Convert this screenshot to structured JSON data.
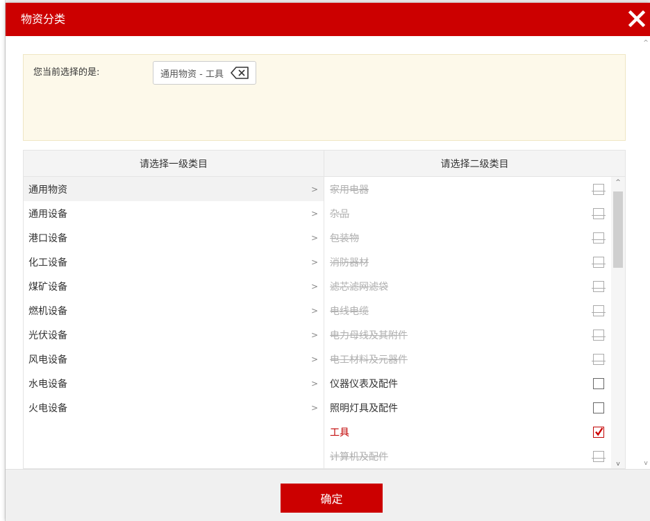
{
  "dialog": {
    "title": "物资分类",
    "close_icon": "close-icon"
  },
  "selection": {
    "label": "您当前选择的是:",
    "tag_text": "通用物资 - 工具",
    "tag_icon": "backspace-delete-icon"
  },
  "primary": {
    "header": "请选择一级类目",
    "chevron": ">",
    "items": [
      {
        "label": "通用物资",
        "active": true
      },
      {
        "label": "通用设备",
        "active": false
      },
      {
        "label": "港口设备",
        "active": false
      },
      {
        "label": "化工设备",
        "active": false
      },
      {
        "label": "煤矿设备",
        "active": false
      },
      {
        "label": "燃机设备",
        "active": false
      },
      {
        "label": "光伏设备",
        "active": false
      },
      {
        "label": "风电设备",
        "active": false
      },
      {
        "label": "水电设备",
        "active": false
      },
      {
        "label": "火电设备",
        "active": false
      }
    ]
  },
  "secondary": {
    "header": "请选择二级类目",
    "items": [
      {
        "label": "家用电器",
        "state": "disabled",
        "checked": false
      },
      {
        "label": "杂品",
        "state": "disabled",
        "checked": false
      },
      {
        "label": "包装物",
        "state": "disabled",
        "checked": false
      },
      {
        "label": "消防器材",
        "state": "disabled",
        "checked": false
      },
      {
        "label": "滤芯滤网滤袋",
        "state": "disabled",
        "checked": false
      },
      {
        "label": "电线电缆",
        "state": "disabled",
        "checked": false
      },
      {
        "label": "电力母线及其附件",
        "state": "disabled",
        "checked": false
      },
      {
        "label": "电工材料及元器件",
        "state": "disabled",
        "checked": false
      },
      {
        "label": "仪器仪表及配件",
        "state": "enabled",
        "checked": false
      },
      {
        "label": "照明灯具及配件",
        "state": "enabled",
        "checked": false
      },
      {
        "label": "工具",
        "state": "selected",
        "checked": true
      },
      {
        "label": "计算机及配件",
        "state": "disabled",
        "checked": false
      }
    ]
  },
  "footer": {
    "confirm_label": "确定"
  },
  "colors": {
    "brand": "#cc0000",
    "selection_bg": "#fdf9ea",
    "disabled_text": "#b0b0b0"
  }
}
